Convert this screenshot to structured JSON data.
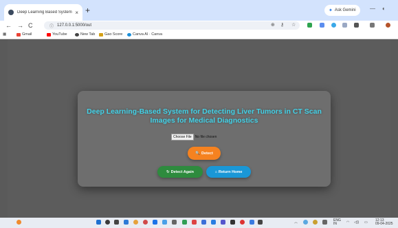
{
  "browser": {
    "tab_title": "Deep Learning Based System D",
    "tab_close": "×",
    "new_tab": "+",
    "gemini_label": "Ask Gemini",
    "url": "127.0.0.1:5000/out",
    "nav": {
      "back": "←",
      "forward": "→",
      "reload": "C"
    },
    "bookmarks": [
      "Gmail",
      "YouTube",
      "New Tab",
      "Gao Score",
      "Canva AI · Canva"
    ]
  },
  "page": {
    "title_line1": "Deep Learning-Based System for Detecting Liver Tumors in CT Scan",
    "title_line2": "Images for Medical Diagnostics",
    "file_button": "Choose File",
    "file_status": "No file chosen",
    "detect_label": "Detect",
    "detect_again_label": "Detect Again",
    "return_home_label": "Return Home"
  },
  "taskbar": {
    "lang_top": "ENG",
    "lang_bottom": "IN",
    "time": "12:13",
    "date": "09-04-2025"
  },
  "colors": {
    "title": "#43d2e8",
    "detect": "#f58220",
    "detect_again": "#2e8b3e",
    "return_home": "#1a97d6"
  }
}
